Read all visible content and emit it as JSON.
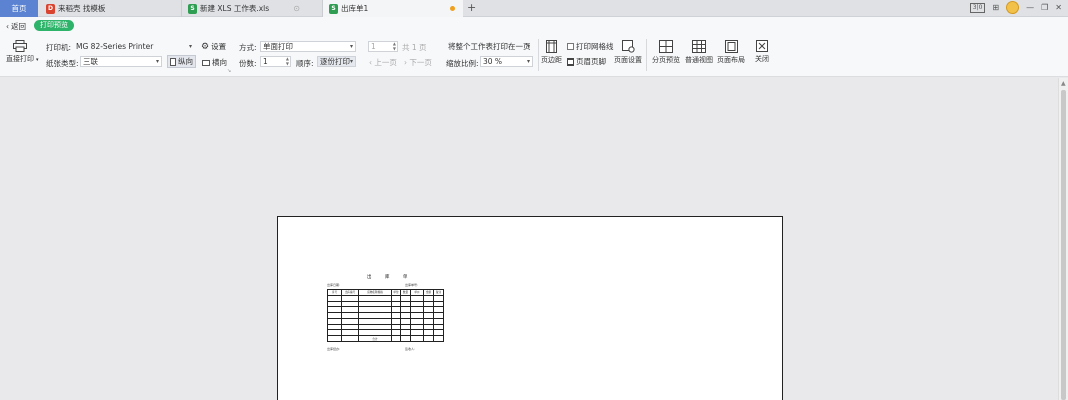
{
  "tabs": {
    "home": "首页",
    "template": "来稻壳 找模板",
    "new_sheet": "新建 XLS 工作表.xls",
    "active": "出库单1",
    "add": "+"
  },
  "window_controls": {
    "badge": "3|0"
  },
  "ribbon": {
    "back": "返回",
    "mode_pill": "打印预览",
    "direct_print": "直接打印",
    "printer_label": "打印机:",
    "printer_value": "MG 82-Series Printer",
    "settings": "设置",
    "paper_type_label": "纸张类型:",
    "paper_type_value": "三联",
    "portrait": "纵向",
    "landscape": "横向",
    "method_label": "方式:",
    "method_value": "单面打印",
    "copies_label": "份数:",
    "copies_value": "1",
    "order_label": "顺序:",
    "order_value": "逐份打印",
    "page_current": "1",
    "page_total": "共 1 页",
    "prev_page": "上一页",
    "next_page": "下一页",
    "fit_value": "将整个工作表打印在一页",
    "zoom_label": "缩放比例:",
    "zoom_value": "30 %",
    "margins": "页边距",
    "print_gridlines": "打印网格线",
    "header_footer": "页眉页脚",
    "page_setup": "页面设置",
    "page_break_preview": "分页预览",
    "normal_view": "普通视图",
    "page_layout": "页面布局",
    "close": "关闭"
  },
  "document": {
    "title": "出 库 单",
    "field_left": "出库日期:",
    "field_right": "出库单号:",
    "footer_left": "出库经办:",
    "footer_right": "签收人:",
    "headers": [
      "序号",
      "出库编号",
      "货物名称规格",
      "单位",
      "数量",
      "单价",
      "金额",
      "备注"
    ],
    "total_label": "合计"
  },
  "colors": {
    "home_tab": "#5b83d1",
    "pill_green": "#2db36a",
    "sheet_icon": "#2f9e53",
    "doc_icon": "#d9432f"
  }
}
